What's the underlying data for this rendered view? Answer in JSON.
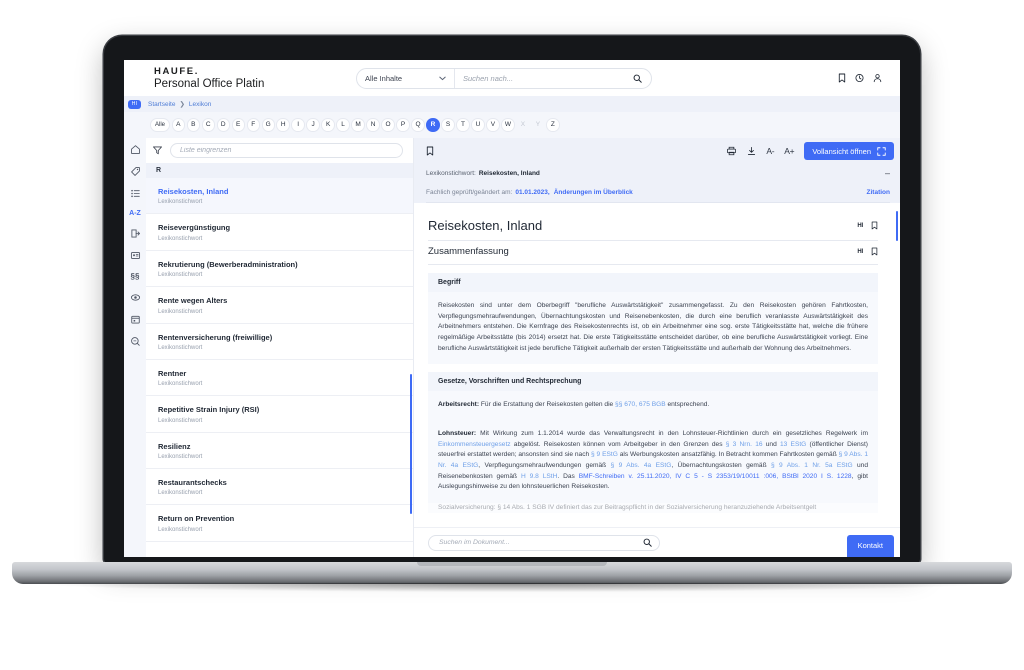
{
  "app": {
    "brand_logo": "HAUFE.",
    "brand_name": "Personal Office Platin"
  },
  "search": {
    "scope_value": "Alle Inhalte",
    "placeholder": "Suchen nach...",
    "value": "",
    "search_icon": "search-icon",
    "chevron": "⌄"
  },
  "topbar_actions": [
    {
      "name": "bookmark-icon",
      "label": "Lesezeichen"
    },
    {
      "name": "history-icon",
      "label": "Verlauf"
    },
    {
      "name": "user-icon",
      "label": "Benutzerkonto"
    }
  ],
  "breadcrumb": {
    "badge": "HI",
    "items": [
      "Startseite",
      "Lexikon"
    ],
    "separator": "❯"
  },
  "alphabet": {
    "all_label": "Alle",
    "letters": [
      "A",
      "B",
      "C",
      "D",
      "E",
      "F",
      "G",
      "H",
      "I",
      "J",
      "K",
      "L",
      "M",
      "N",
      "O",
      "P",
      "Q",
      "R",
      "S",
      "T",
      "U",
      "V",
      "W",
      "X",
      "Y",
      "Z"
    ],
    "active": "R",
    "disabled": [
      "X",
      "Y"
    ]
  },
  "rail": [
    {
      "name": "home-icon",
      "label": "Startseite",
      "active": false
    },
    {
      "name": "tag-icon",
      "label": "Themen",
      "active": false
    },
    {
      "name": "list-icon",
      "label": "Inhalte",
      "active": false
    },
    {
      "name": "az-icon",
      "label": "A-Z",
      "active": true,
      "text": "A-Z"
    },
    {
      "name": "export-icon",
      "label": "Arbeitshilfen",
      "active": false
    },
    {
      "name": "news-icon",
      "label": "News",
      "active": false
    },
    {
      "name": "paragraph-icon",
      "label": "Gesetze",
      "active": false
    },
    {
      "name": "globe-icon",
      "label": "Rechner",
      "active": false
    },
    {
      "name": "calendar-icon",
      "label": "Termine",
      "active": false
    },
    {
      "name": "magnify-icon",
      "label": "Suche",
      "active": false
    }
  ],
  "list_panel": {
    "filter_icon": "filter-icon",
    "filter_placeholder": "Liste eingrenzen",
    "filter_value": "",
    "section_header": "R",
    "item_subtitle": "Lexikonstichwort",
    "items": [
      {
        "title": "Reisekosten, Inland",
        "subtitle": "Lexikonstichwort",
        "selected": true
      },
      {
        "title": "Reisevergünstigung",
        "subtitle": "Lexikonstichwort",
        "selected": false
      },
      {
        "title": "Rekrutierung (Bewerberadministration)",
        "subtitle": "Lexikonstichwort",
        "selected": false
      },
      {
        "title": "Rente wegen Alters",
        "subtitle": "Lexikonstichwort",
        "selected": false
      },
      {
        "title": "Rentenversicherung (freiwillige)",
        "subtitle": "Lexikonstichwort",
        "selected": false
      },
      {
        "title": "Rentner",
        "subtitle": "Lexikonstichwort",
        "selected": false
      },
      {
        "title": "Repetitive Strain Injury (RSI)",
        "subtitle": "Lexikonstichwort",
        "selected": false
      },
      {
        "title": "Resilienz",
        "subtitle": "Lexikonstichwort",
        "selected": false
      },
      {
        "title": "Restaurantschecks",
        "subtitle": "Lexikonstichwort",
        "selected": false
      },
      {
        "title": "Return on Prevention",
        "subtitle": "Lexikonstichwort",
        "selected": false
      }
    ]
  },
  "doc_toolbar": {
    "bookmark_icon": "bookmark-icon",
    "print_icon": "print-icon",
    "download_icon": "download-icon",
    "font_decrease": "A-",
    "font_increase": "A+",
    "fullview_label": "Vollansicht öffnen",
    "fullview_icon": "expand-icon"
  },
  "doc_meta": {
    "kind_label": "Lexikonstichwort:",
    "kind_value": "Reisekosten, Inland",
    "collapse": "–",
    "checked_label": "Fachlich geprüft/geändert am:",
    "checked_date": "01.01.2023,",
    "changes_link": "Änderungen im Überblick",
    "citation_label": "Zitation"
  },
  "document": {
    "title": "Reisekosten, Inland",
    "section_title": "Zusammenfassung",
    "hi_icon": "HI",
    "bookmark_icon": "bookmark-icon",
    "blocks": [
      {
        "header": "Begriff",
        "paragraphs": [
          "Reisekosten sind unter dem Oberbegriff \"berufliche Auswärtstätigkeit\" zusammengefasst. Zu den Reisekosten gehören Fahrtkosten, Verpflegungsmehraufwendungen, Übernachtungskosten und Reisenebenkosten, die durch eine beruflich veranlasste Auswärtstätigkeit des Arbeitnehmers entstehen. Die Kernfrage des Reisekostenrechts ist, ob ein Arbeitnehmer eine sog. erste Tätigkeitsstätte hat, welche die frühere regelmäßige Arbeitsstätte (bis 2014) ersetzt hat. Die erste Tätigkeitsstätte entscheidet darüber, ob eine berufliche Auswärtstätigkeit vorliegt. Eine berufliche Auswärtstätigkeit ist jede berufliche Tätigkeit außerhalb der ersten Tätigkeitsstätte und außerhalb der Wohnung des Arbeitnehmers."
        ]
      },
      {
        "header": "Gesetze, Vorschriften und Rechtsprechung",
        "paragraphs": []
      }
    ],
    "arbeitsrecht": {
      "label": "Arbeitsrecht:",
      "text_1": " Für die Erstattung der Reisekosten gelten die ",
      "link_1": "§§ 670, 675 BGB",
      "text_2": " entsprechend."
    },
    "lohnsteuer": {
      "label": "Lohnsteuer:",
      "t1": " Mit Wirkung zum 1.1.2014 wurde das Verwaltungsrecht in den Lohnsteuer-Richtlinien durch ein gesetzliches Regelwerk im ",
      "l1": "Einkommensteuergesetz",
      "t2": " abgelöst. Reisekosten können vom Arbeitgeber in den Grenzen des ",
      "l2": "§ 3 Nrn. 16",
      "t3": " und ",
      "l3": "13 EStG",
      "t4": " (öffentlicher Dienst) steuerfrei erstattet werden; ansonsten sind sie nach ",
      "l4": "§ 9 EStG",
      "t5": " als Werbungskosten ansatzfähig. In Betracht kommen Fahrtkosten gemäß ",
      "l5": "§ 9 Abs. 1 Nr. 4a EStG",
      "t6": ", Verpflegungsmehraufwendungen gemäß ",
      "l6": "§ 9 Abs. 4a EStG",
      "t7": ", Übernachtungskosten gemäß ",
      "l7": "§ 9 Abs. 1 Nr. 5a EStG",
      "t8": " und Reisenebenkosten gemäß ",
      "l8": "H 9.8 LStH",
      "t9": ". Das ",
      "l9": "BMF-Schreiben v. 25.11.2020, IV C 5 - S 2353/19/10011 :006, BStBl 2020 I S. 1228",
      "t10": ", gibt Auslegungshinweise zu den lohnsteuerlichen Reisekosten."
    },
    "cut_line": "Sozialversicherung: § 14 Abs. 1 SGB IV definiert das zur Beitragspflicht in der Sozialversicherung heranzuziehende Arbeitsentgelt"
  },
  "doc_footer": {
    "search_placeholder": "Suchen im Dokument...",
    "search_value": "",
    "search_icon": "search-icon",
    "contact_label": "Kontakt"
  },
  "colors": {
    "accent": "#3f6bf5",
    "link": "#6fa0e8",
    "panel": "#eef1f9",
    "page_bg": "#f4f6fb"
  }
}
